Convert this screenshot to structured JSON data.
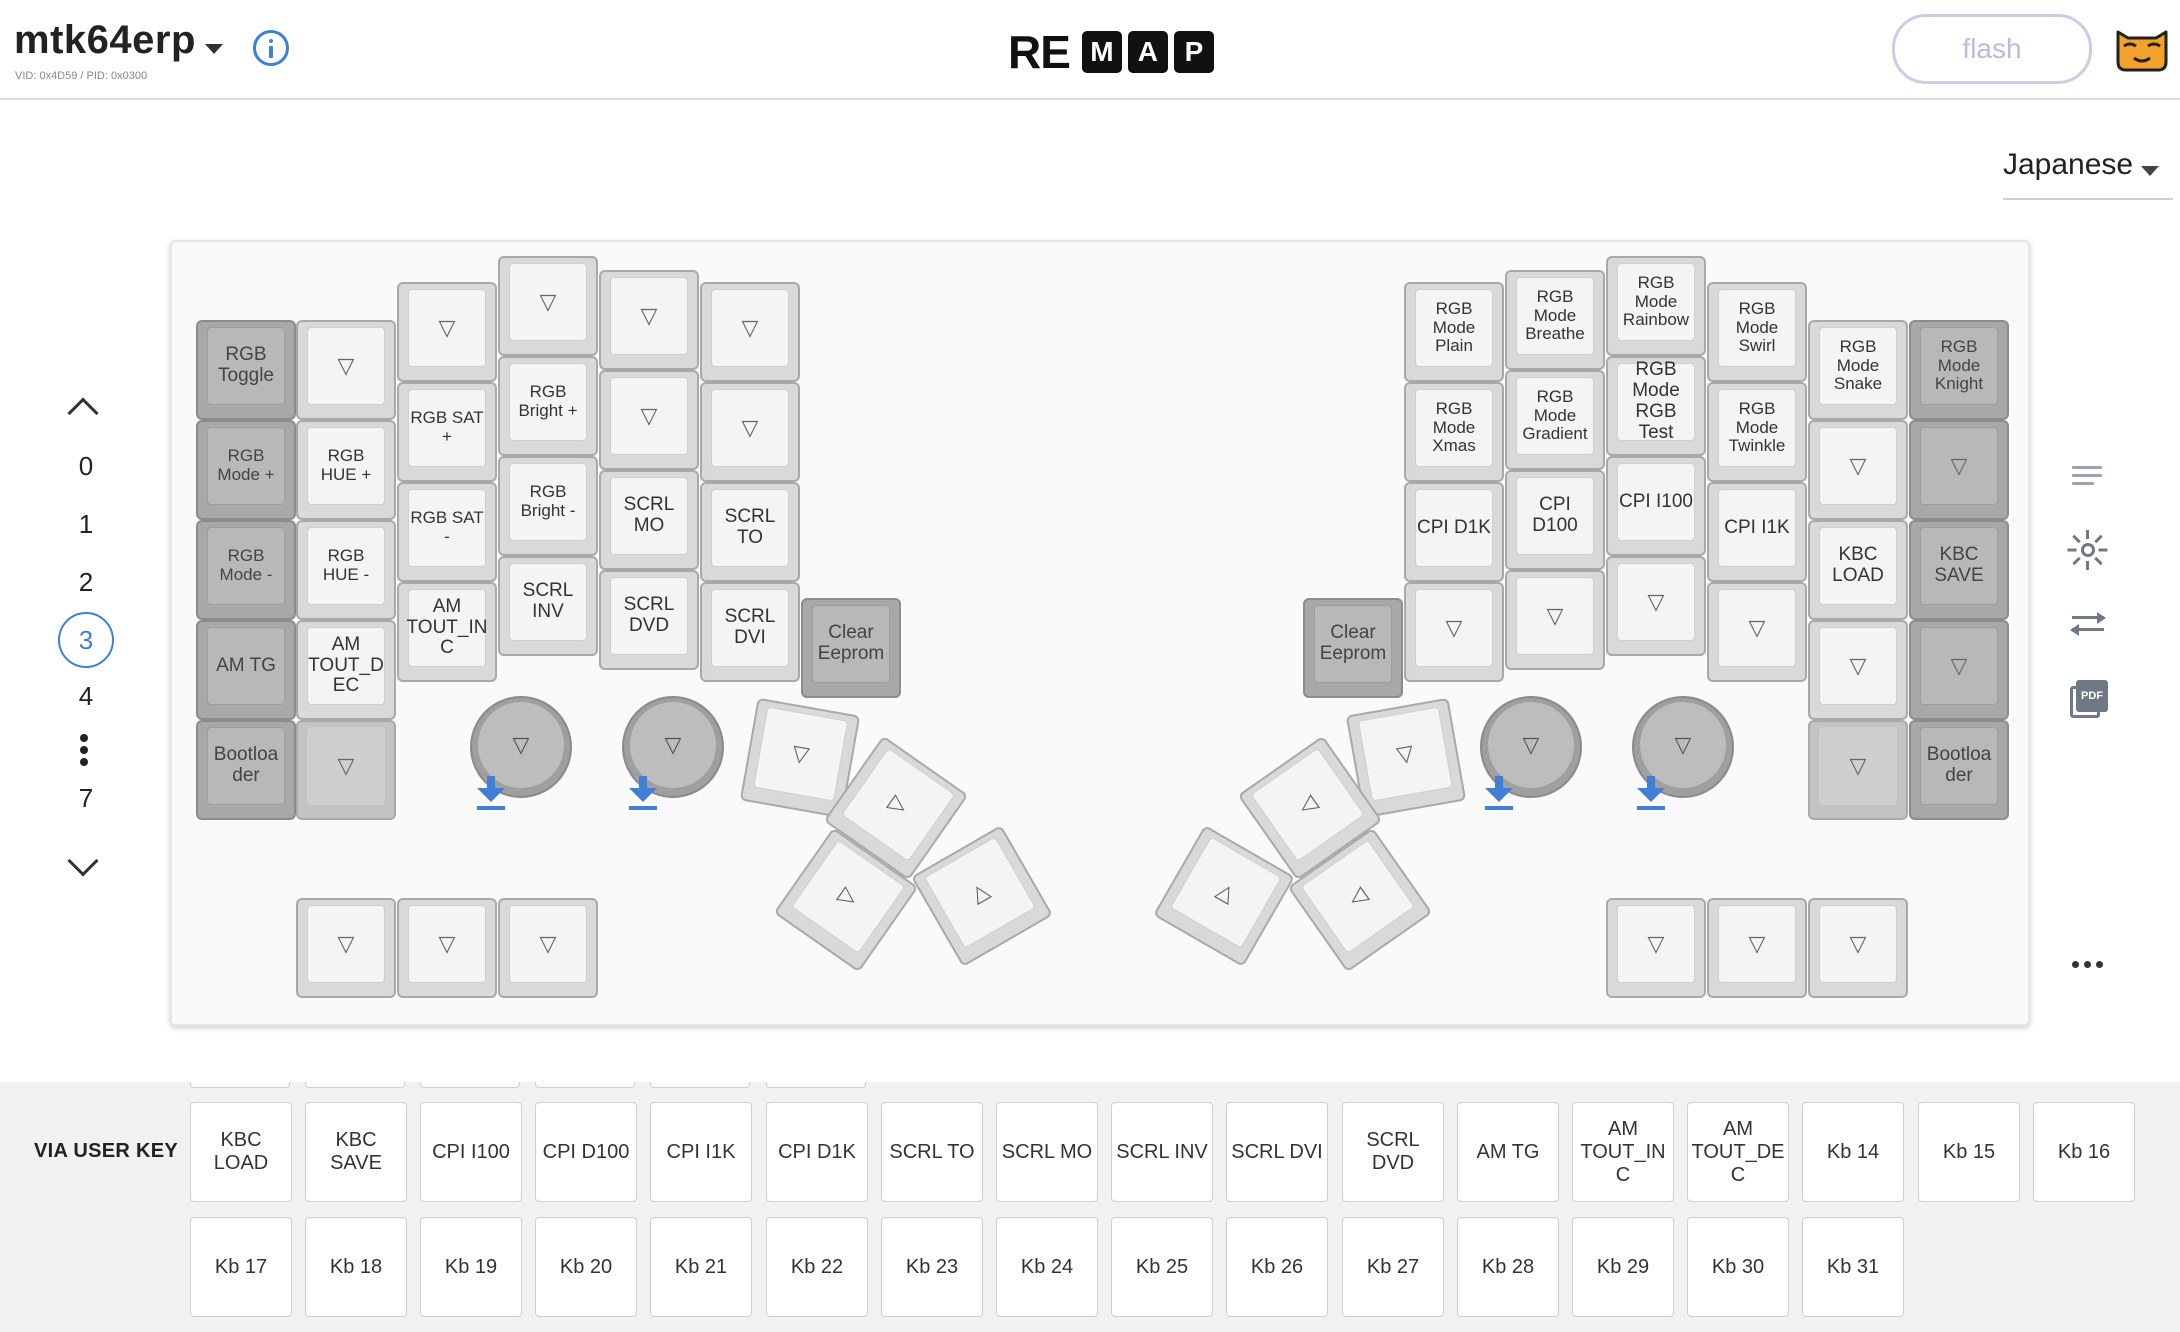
{
  "header": {
    "keyboard_name": "mtk64erp",
    "vid_pid": "VID: 0x4D59 / PID: 0x0300",
    "logo_plain": "RE",
    "logo_boxed": [
      "M",
      "A",
      "P"
    ],
    "flash_label": "flash"
  },
  "language": {
    "selected": "Japanese"
  },
  "layers": {
    "items": [
      "0",
      "1",
      "2",
      "3",
      "4",
      "7"
    ],
    "active": "3"
  },
  "key_labels": {
    "rgb_toggle": "RGB Toggle",
    "rgb_mode_plus": "RGB Mode +",
    "rgb_mode_minus": "RGB Mode -",
    "am_tg": "AM TG",
    "bootloader": "Bootloa der",
    "rgb_hue_plus": "RGB HUE +",
    "rgb_hue_minus": "RGB HUE -",
    "am_tout_dec": "AM TOUT_D EC",
    "rgb_sat_plus": "RGB SAT +",
    "rgb_sat_minus": "RGB SAT -",
    "am_tout_inc": "AM TOUT_IN C",
    "rgb_bright_plus": "RGB Bright +",
    "rgb_bright_minus": "RGB Bright -",
    "scrl_inv": "SCRL INV",
    "scrl_mo": "SCRL MO",
    "scrl_dvd": "SCRL DVD",
    "scrl_to": "SCRL TO",
    "scrl_dvi": "SCRL DVI",
    "clear_eeprom": "Clear Eeprom",
    "rgb_mode_plain": "RGB Mode Plain",
    "rgb_mode_xmas": "RGB Mode Xmas",
    "cpi_d1k": "CPI D1K",
    "rgb_mode_breathe": "RGB Mode Breathe",
    "rgb_mode_gradient": "RGB Mode Gradient",
    "cpi_d100": "CPI D100",
    "rgb_mode_rainbow": "RGB Mode Rainbow",
    "rgb_mode_rgb_test": "RGB Mode RGB Test",
    "cpi_i100": "CPI I100",
    "rgb_mode_swirl": "RGB Mode Swirl",
    "rgb_mode_twinkle": "RGB Mode Twinkle",
    "cpi_i1k": "CPI I1K",
    "rgb_mode_snake": "RGB Mode Snake",
    "kbc_load": "KBC LOAD",
    "rgb_mode_knight": "RGB Mode Knight",
    "kbc_save": "KBC SAVE",
    "transparent": "▽",
    "arrow_right": "▷",
    "arrow_left": "◁",
    "arrow_up": "△"
  },
  "palette": {
    "title": "VIA USER KEY",
    "keys": [
      "KBC LOAD",
      "KBC SAVE",
      "CPI I100",
      "CPI D100",
      "CPI I1K",
      "CPI D1K",
      "SCRL TO",
      "SCRL MO",
      "SCRL INV",
      "SCRL DVI",
      "SCRL DVD",
      "AM TG",
      "AM TOUT_IN C",
      "AM TOUT_DE C",
      "Kb 14",
      "Kb 15",
      "Kb 16",
      "Kb 17",
      "Kb 18",
      "Kb 19",
      "Kb 20",
      "Kb 21",
      "Kb 22",
      "Kb 23",
      "Kb 24",
      "Kb 25",
      "Kb 26",
      "Kb 27",
      "Kb 28",
      "Kb 29",
      "Kb 30",
      "Kb 31"
    ]
  },
  "colors": {
    "accent": "#3f7fd8",
    "flash_border": "#c9cde6",
    "key_dark": "#a8a8a8",
    "key_light": "#d9d9d9"
  },
  "icons": [
    "info-icon",
    "mascot-icon",
    "chevron-up-icon",
    "chevron-down-icon",
    "list-lines-icon",
    "brightness-icon",
    "swap-arrows-icon",
    "pdf-icon",
    "more-horizontal-icon",
    "encoder-arrow-icon"
  ]
}
